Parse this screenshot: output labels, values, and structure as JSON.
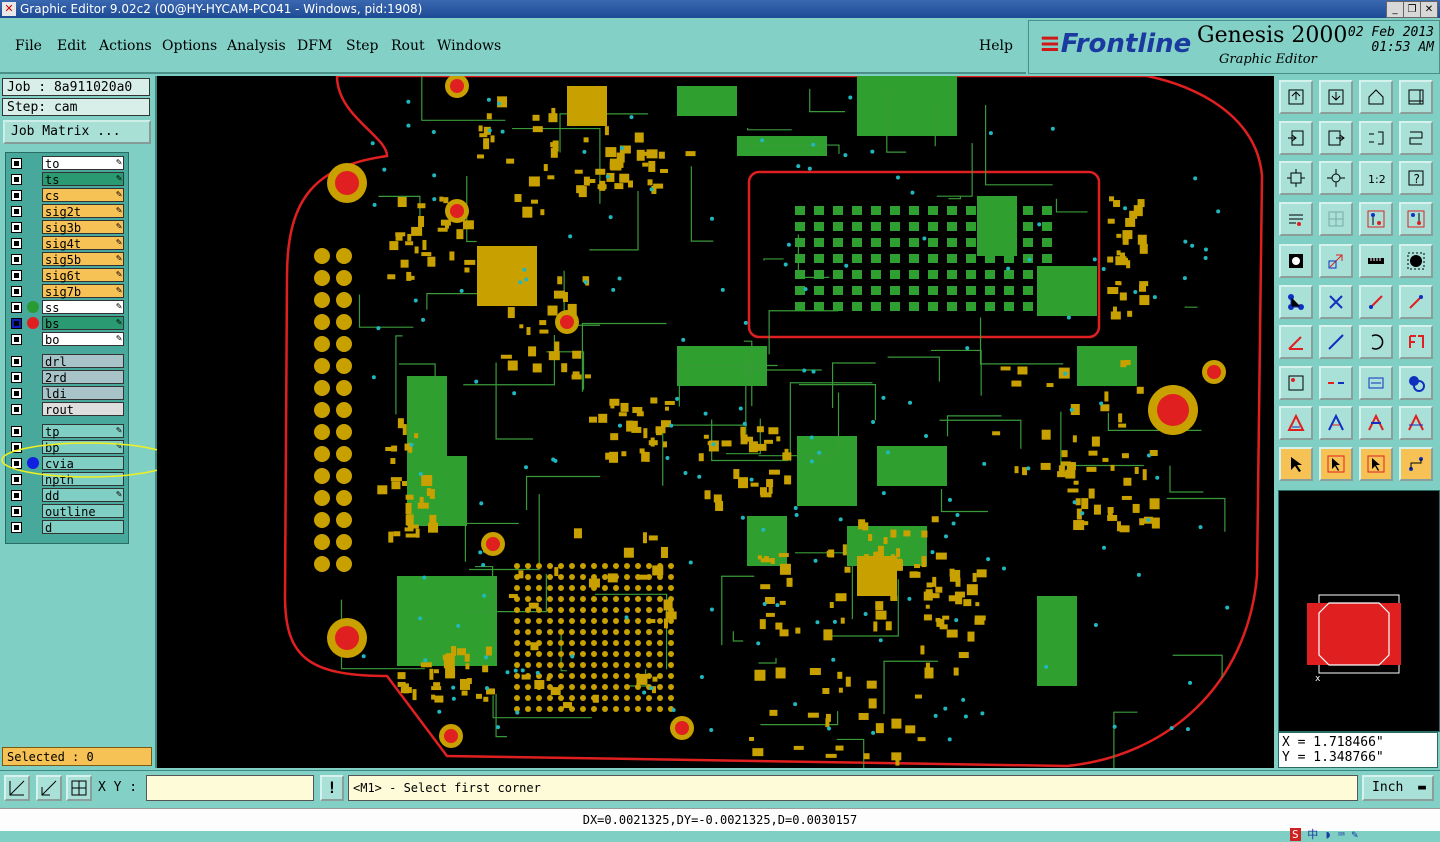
{
  "window": {
    "title": "Graphic Editor 9.02c2 (00@HY-HYCAM-PC041 - Windows, pid:1908)"
  },
  "menu": [
    "File",
    "Edit",
    "Actions",
    "Options",
    "Analysis",
    "DFM",
    "Step",
    "Rout",
    "Windows"
  ],
  "help_label": "Help",
  "brand": {
    "logo": "Frontline",
    "product": "Genesis 2000",
    "subtitle": "Graphic Editor",
    "date": "02 Feb 2013",
    "time": "01:53 AM"
  },
  "job": {
    "job_label": "Job : 8a911020a0",
    "step_label": "Step: cam",
    "matrix_button": "Job Matrix ..."
  },
  "layers": [
    {
      "name": "to",
      "color": "#ffffff",
      "checked": false,
      "dot": "",
      "editable": true
    },
    {
      "name": "ts",
      "color": "#2a9a72",
      "checked": false,
      "dot": "",
      "editable": true
    },
    {
      "name": "cs",
      "color": "#f6c256",
      "checked": false,
      "dot": "",
      "editable": true
    },
    {
      "name": "sig2t",
      "color": "#f6c256",
      "checked": false,
      "dot": "",
      "editable": true
    },
    {
      "name": "sig3b",
      "color": "#f6c256",
      "checked": false,
      "dot": "",
      "editable": true
    },
    {
      "name": "sig4t",
      "color": "#f6c256",
      "checked": false,
      "dot": "",
      "editable": true
    },
    {
      "name": "sig5b",
      "color": "#f6c256",
      "checked": false,
      "dot": "",
      "editable": true
    },
    {
      "name": "sig6t",
      "color": "#f6c256",
      "checked": false,
      "dot": "",
      "editable": true
    },
    {
      "name": "sig7b",
      "color": "#f6c256",
      "checked": false,
      "dot": "",
      "editable": true
    },
    {
      "name": "ss",
      "color": "#ffffff",
      "checked": false,
      "dot": "#2a9a32",
      "editable": true
    },
    {
      "name": "bs",
      "color": "#2a9a72",
      "checked": true,
      "dot": "#e02020",
      "editable": true
    },
    {
      "name": "bo",
      "color": "#ffffff",
      "checked": false,
      "dot": "",
      "editable": true
    },
    {
      "name": "drl",
      "color": "#a9c4c8",
      "checked": false,
      "dot": "",
      "editable": false
    },
    {
      "name": "2rd",
      "color": "#a9c4c8",
      "checked": false,
      "dot": "",
      "editable": false
    },
    {
      "name": "ldi",
      "color": "#a9c4c8",
      "checked": false,
      "dot": "",
      "editable": false
    },
    {
      "name": "rout",
      "color": "#dedede",
      "checked": false,
      "dot": "",
      "editable": false
    },
    {
      "name": "tp",
      "color": "#7fcfc4",
      "checked": false,
      "dot": "",
      "editable": true
    },
    {
      "name": "bp",
      "color": "#7fcfc4",
      "checked": false,
      "dot": "",
      "editable": true
    },
    {
      "name": "cvia",
      "color": "#7fcfc4",
      "checked": false,
      "dot": "#1020e0",
      "editable": false
    },
    {
      "name": "npth",
      "color": "#7fcfc4",
      "checked": false,
      "dot": "",
      "editable": false
    },
    {
      "name": "dd",
      "color": "#7fcfc4",
      "checked": false,
      "dot": "",
      "editable": true
    },
    {
      "name": "outline",
      "color": "#7fcfc4",
      "checked": false,
      "dot": "",
      "editable": false
    },
    {
      "name": "d",
      "color": "#7fcfc4",
      "checked": false,
      "dot": "",
      "editable": false
    }
  ],
  "selected": "Selected : 0",
  "tools": [
    "layer-up-icon",
    "layer-down-icon",
    "home-icon",
    "window-icon",
    "zoom-left-icon",
    "zoom-right-icon",
    "swap-icon",
    "mirror-icon",
    "fit-icon",
    "center-icon",
    "ratio-icon",
    "help-icon",
    "snap-icon",
    "grid-icon",
    "measure-a-icon",
    "measure-b-icon",
    "pad-icon",
    "shape-icon",
    "ruler-icon",
    "dot-icon",
    "net-icon",
    "cross-icon",
    "line-red-icon",
    "line-dot-icon",
    "angle-icon",
    "slash-icon",
    "arc-icon",
    "pin-icon",
    "select-box-icon",
    "split-icon",
    "range-icon",
    "ring-icon",
    "tri-a-icon",
    "tri-b-icon",
    "tri-c-icon",
    "tri-d-icon",
    "pointer-icon",
    "pointer-box-icon",
    "pointer-sel-icon",
    "route-icon"
  ],
  "tool_ratio_label": "1:2",
  "coords": {
    "x": "X = 1.718466\"",
    "y": "Y = 1.348766\""
  },
  "command": {
    "xy_label": "X Y :",
    "xy_value": "",
    "bang": "!",
    "prompt": "<M1> - Select first corner",
    "unit": "Inch"
  },
  "status": "DX=0.0021325,DY=-0.0021325,D=0.0030157",
  "colors": {
    "copper": "#c8a000",
    "plane": "#2fa02f",
    "trace": "#3a9a3a",
    "via": "#20b8c0",
    "board_edge": "#e02020",
    "drill": "#e02020"
  }
}
